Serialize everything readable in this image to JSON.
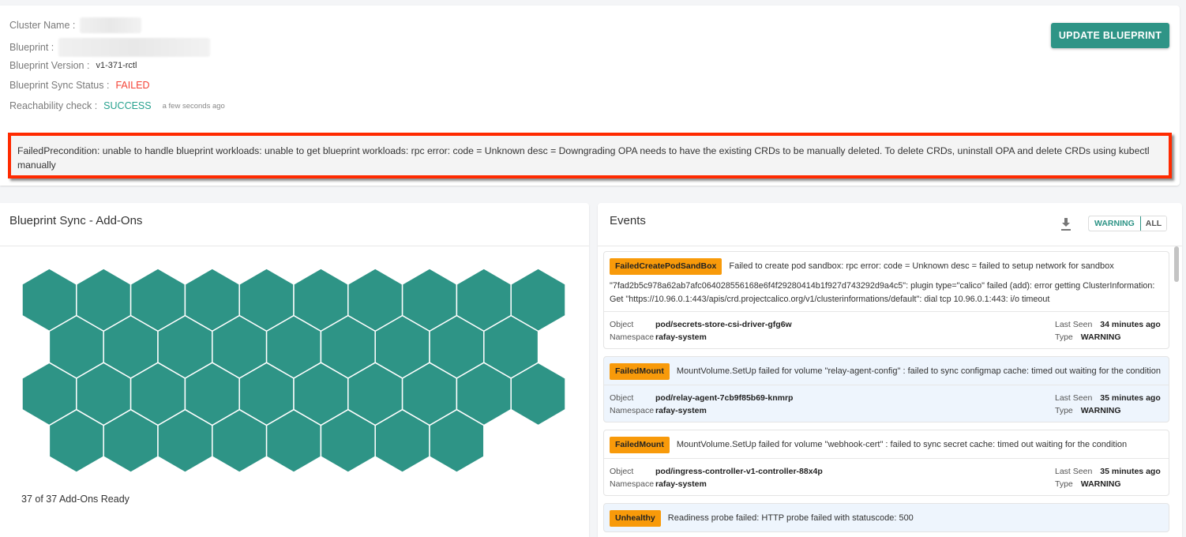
{
  "cluster_info": {
    "cluster_name_label": "Cluster Name :",
    "blueprint_label": "Blueprint :",
    "blueprint_version_label": "Blueprint Version :",
    "blueprint_version": "v1-371-rctl",
    "sync_status_label": "Blueprint Sync Status :",
    "sync_status": "FAILED",
    "reachability_label": "Reachability check :",
    "reachability_status": "SUCCESS",
    "reachability_time": "a few seconds ago"
  },
  "actions": {
    "update_blueprint_label": "UPDATE BLUEPRINT"
  },
  "error_message": "FailedPrecondition: unable to handle blueprint workloads: unable to get blueprint workloads: rpc error: code = Unknown desc = Downgrading OPA needs to have the existing CRDs to be manually deleted. To delete CRDs, uninstall OPA and delete CRDs using kubectl manually",
  "addons": {
    "title": "Blueprint Sync - Add-Ons",
    "ready_count": 37,
    "total_count": 37,
    "summary": "37 of 37 Add-Ons Ready",
    "rows": [
      10,
      9,
      10,
      8
    ],
    "hex_color": "#2e9486"
  },
  "events": {
    "title": "Events",
    "filters": [
      "WARNING",
      "ALL"
    ],
    "active_filter": "WARNING",
    "labels": {
      "object": "Object",
      "namespace": "Namespace",
      "last_seen": "Last Seen",
      "type": "Type"
    },
    "items": [
      {
        "reason": "FailedCreatePodSandBox",
        "message": "Failed to create pod sandbox: rpc error: code = Unknown desc = failed to setup network for sandbox",
        "extra": "\"7fad2b5c978a62ab7afc064028556168e6f4f29280414b1f927d743292d9a4c5\": plugin type=\"calico\" failed (add): error getting ClusterInformation: Get \"https://10.96.0.1:443/apis/crd.projectcalico.org/v1/clusterinformations/default\": dial tcp 10.96.0.1:443: i/o timeout",
        "object": "pod/secrets-store-csi-driver-gfg6w",
        "namespace": "rafay-system",
        "last_seen": "34 minutes ago",
        "type": "WARNING"
      },
      {
        "reason": "FailedMount",
        "message": "MountVolume.SetUp failed for volume \"relay-agent-config\" : failed to sync configmap cache: timed out waiting for the condition",
        "object": "pod/relay-agent-7cb9f85b69-knmrp",
        "namespace": "rafay-system",
        "last_seen": "35 minutes ago",
        "type": "WARNING"
      },
      {
        "reason": "FailedMount",
        "message": "MountVolume.SetUp failed for volume \"webhook-cert\" : failed to sync secret cache: timed out waiting for the condition",
        "object": "pod/ingress-controller-v1-controller-88x4p",
        "namespace": "rafay-system",
        "last_seen": "35 minutes ago",
        "type": "WARNING"
      },
      {
        "reason": "Unhealthy",
        "message": "Readiness probe failed: HTTP probe failed with statuscode: 500"
      }
    ]
  },
  "colors": {
    "accent": "#2e9486",
    "failed": "#f44336",
    "success": "#26a18e",
    "badge": "#f89a0a",
    "error_border": "#ff2a00"
  }
}
